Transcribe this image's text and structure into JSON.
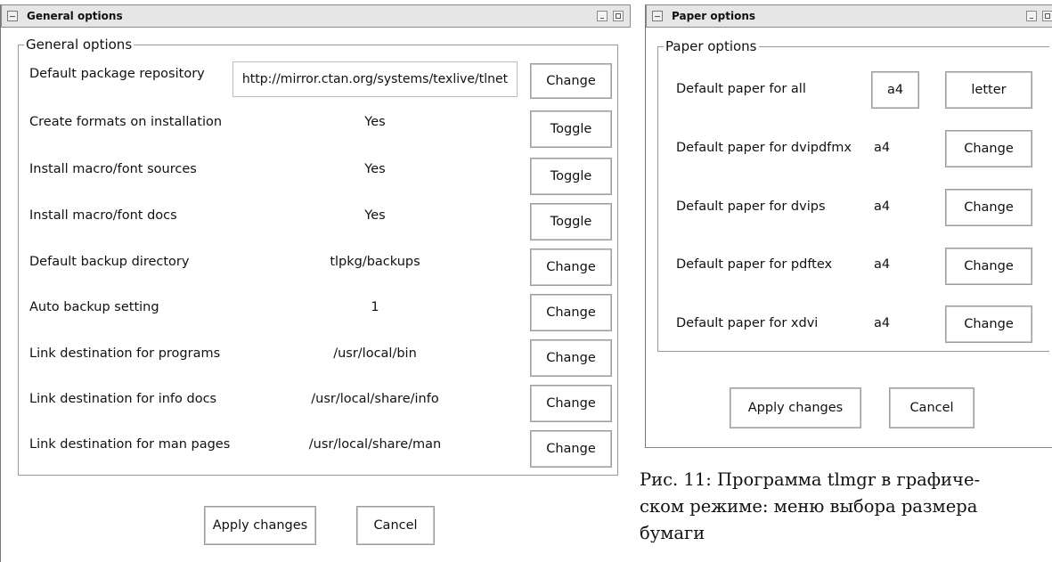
{
  "left_window": {
    "title": "General options",
    "group_legend": "General options",
    "rows": [
      {
        "label": "Default package repository",
        "value": "http://mirror.ctan.org/systems/texlive/tlnet",
        "button": "Change"
      },
      {
        "label": "Create formats on installation",
        "value": "Yes",
        "button": "Toggle"
      },
      {
        "label": "Install macro/font sources",
        "value": "Yes",
        "button": "Toggle"
      },
      {
        "label": "Install macro/font docs",
        "value": "Yes",
        "button": "Toggle"
      },
      {
        "label": "Default backup directory",
        "value": "tlpkg/backups",
        "button": "Change"
      },
      {
        "label": "Auto backup setting",
        "value": "1",
        "button": "Change"
      },
      {
        "label": "Link destination for programs",
        "value": "/usr/local/bin",
        "button": "Change"
      },
      {
        "label": "Link destination for info docs",
        "value": "/usr/local/share/info",
        "button": "Change"
      },
      {
        "label": "Link destination for man pages",
        "value": "/usr/local/share/man",
        "button": "Change"
      }
    ],
    "apply_label": "Apply changes",
    "cancel_label": "Cancel"
  },
  "right_window": {
    "title": "Paper options",
    "group_legend": "Paper options",
    "all_row": {
      "label": "Default paper for all",
      "option_a4": "a4",
      "option_letter": "letter"
    },
    "rows": [
      {
        "label": "Default paper for dvipdfmx",
        "value": "a4",
        "button": "Change"
      },
      {
        "label": "Default paper for dvips",
        "value": "a4",
        "button": "Change"
      },
      {
        "label": "Default paper for pdftex",
        "value": "a4",
        "button": "Change"
      },
      {
        "label": "Default paper for xdvi",
        "value": "a4",
        "button": "Change"
      }
    ],
    "apply_label": "Apply changes",
    "cancel_label": "Cancel"
  },
  "caption": {
    "line1": "Рис. 11: Программа tlmgr в графиче-",
    "line2": "ском режиме: меню выбора размера",
    "line3": "бумаги"
  }
}
